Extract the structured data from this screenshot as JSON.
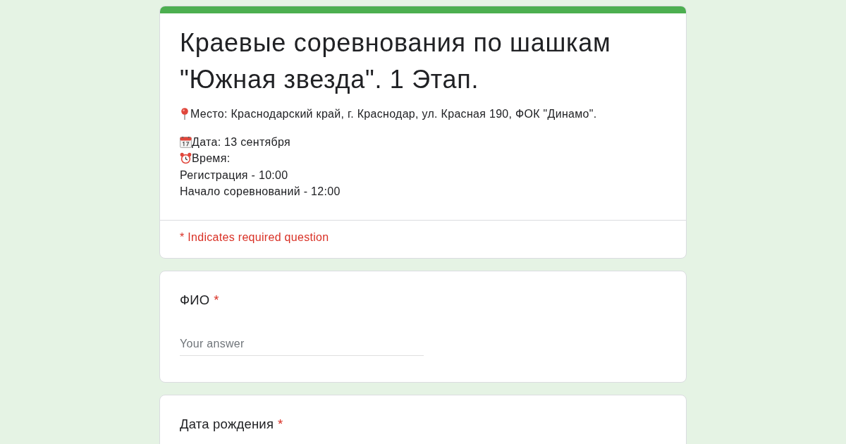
{
  "form": {
    "title": "Краевые соревнования по шашкам \"Южная звезда\". 1 Этап.",
    "description": [
      [
        {
          "kind": "place",
          "text": "Место: Краснодарский край, г. Краснодар, ул. Красная 190, ФОК \"Динамо\"."
        }
      ],
      [
        {
          "kind": "date",
          "text": "Дата: 13 сентября"
        },
        {
          "kind": "time",
          "text": "Время:"
        },
        {
          "kind": "plain",
          "text": "Регистрация - 10:00"
        },
        {
          "kind": "plain",
          "text": "Начало соревнований - 12:00"
        }
      ]
    ],
    "required_note": "* Indicates required question"
  },
  "questions": [
    {
      "label": "ФИО",
      "required_mark": "*",
      "placeholder": "Your answer"
    },
    {
      "label": "Дата рождения",
      "required_mark": "*"
    }
  ]
}
